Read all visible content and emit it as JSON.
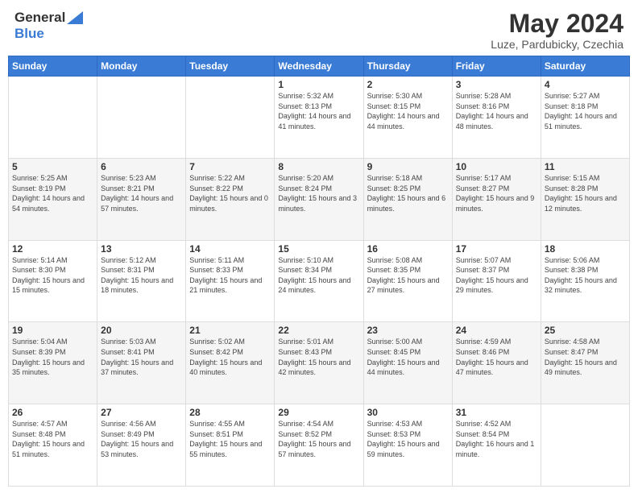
{
  "header": {
    "logo_general": "General",
    "logo_blue": "Blue",
    "title": "May 2024",
    "subtitle": "Luze, Pardubicky, Czechia"
  },
  "days_of_week": [
    "Sunday",
    "Monday",
    "Tuesday",
    "Wednesday",
    "Thursday",
    "Friday",
    "Saturday"
  ],
  "weeks": [
    [
      {
        "day": "",
        "sunrise": "",
        "sunset": "",
        "daylight": ""
      },
      {
        "day": "",
        "sunrise": "",
        "sunset": "",
        "daylight": ""
      },
      {
        "day": "",
        "sunrise": "",
        "sunset": "",
        "daylight": ""
      },
      {
        "day": "1",
        "sunrise": "Sunrise: 5:32 AM",
        "sunset": "Sunset: 8:13 PM",
        "daylight": "Daylight: 14 hours and 41 minutes."
      },
      {
        "day": "2",
        "sunrise": "Sunrise: 5:30 AM",
        "sunset": "Sunset: 8:15 PM",
        "daylight": "Daylight: 14 hours and 44 minutes."
      },
      {
        "day": "3",
        "sunrise": "Sunrise: 5:28 AM",
        "sunset": "Sunset: 8:16 PM",
        "daylight": "Daylight: 14 hours and 48 minutes."
      },
      {
        "day": "4",
        "sunrise": "Sunrise: 5:27 AM",
        "sunset": "Sunset: 8:18 PM",
        "daylight": "Daylight: 14 hours and 51 minutes."
      }
    ],
    [
      {
        "day": "5",
        "sunrise": "Sunrise: 5:25 AM",
        "sunset": "Sunset: 8:19 PM",
        "daylight": "Daylight: 14 hours and 54 minutes."
      },
      {
        "day": "6",
        "sunrise": "Sunrise: 5:23 AM",
        "sunset": "Sunset: 8:21 PM",
        "daylight": "Daylight: 14 hours and 57 minutes."
      },
      {
        "day": "7",
        "sunrise": "Sunrise: 5:22 AM",
        "sunset": "Sunset: 8:22 PM",
        "daylight": "Daylight: 15 hours and 0 minutes."
      },
      {
        "day": "8",
        "sunrise": "Sunrise: 5:20 AM",
        "sunset": "Sunset: 8:24 PM",
        "daylight": "Daylight: 15 hours and 3 minutes."
      },
      {
        "day": "9",
        "sunrise": "Sunrise: 5:18 AM",
        "sunset": "Sunset: 8:25 PM",
        "daylight": "Daylight: 15 hours and 6 minutes."
      },
      {
        "day": "10",
        "sunrise": "Sunrise: 5:17 AM",
        "sunset": "Sunset: 8:27 PM",
        "daylight": "Daylight: 15 hours and 9 minutes."
      },
      {
        "day": "11",
        "sunrise": "Sunrise: 5:15 AM",
        "sunset": "Sunset: 8:28 PM",
        "daylight": "Daylight: 15 hours and 12 minutes."
      }
    ],
    [
      {
        "day": "12",
        "sunrise": "Sunrise: 5:14 AM",
        "sunset": "Sunset: 8:30 PM",
        "daylight": "Daylight: 15 hours and 15 minutes."
      },
      {
        "day": "13",
        "sunrise": "Sunrise: 5:12 AM",
        "sunset": "Sunset: 8:31 PM",
        "daylight": "Daylight: 15 hours and 18 minutes."
      },
      {
        "day": "14",
        "sunrise": "Sunrise: 5:11 AM",
        "sunset": "Sunset: 8:33 PM",
        "daylight": "Daylight: 15 hours and 21 minutes."
      },
      {
        "day": "15",
        "sunrise": "Sunrise: 5:10 AM",
        "sunset": "Sunset: 8:34 PM",
        "daylight": "Daylight: 15 hours and 24 minutes."
      },
      {
        "day": "16",
        "sunrise": "Sunrise: 5:08 AM",
        "sunset": "Sunset: 8:35 PM",
        "daylight": "Daylight: 15 hours and 27 minutes."
      },
      {
        "day": "17",
        "sunrise": "Sunrise: 5:07 AM",
        "sunset": "Sunset: 8:37 PM",
        "daylight": "Daylight: 15 hours and 29 minutes."
      },
      {
        "day": "18",
        "sunrise": "Sunrise: 5:06 AM",
        "sunset": "Sunset: 8:38 PM",
        "daylight": "Daylight: 15 hours and 32 minutes."
      }
    ],
    [
      {
        "day": "19",
        "sunrise": "Sunrise: 5:04 AM",
        "sunset": "Sunset: 8:39 PM",
        "daylight": "Daylight: 15 hours and 35 minutes."
      },
      {
        "day": "20",
        "sunrise": "Sunrise: 5:03 AM",
        "sunset": "Sunset: 8:41 PM",
        "daylight": "Daylight: 15 hours and 37 minutes."
      },
      {
        "day": "21",
        "sunrise": "Sunrise: 5:02 AM",
        "sunset": "Sunset: 8:42 PM",
        "daylight": "Daylight: 15 hours and 40 minutes."
      },
      {
        "day": "22",
        "sunrise": "Sunrise: 5:01 AM",
        "sunset": "Sunset: 8:43 PM",
        "daylight": "Daylight: 15 hours and 42 minutes."
      },
      {
        "day": "23",
        "sunrise": "Sunrise: 5:00 AM",
        "sunset": "Sunset: 8:45 PM",
        "daylight": "Daylight: 15 hours and 44 minutes."
      },
      {
        "day": "24",
        "sunrise": "Sunrise: 4:59 AM",
        "sunset": "Sunset: 8:46 PM",
        "daylight": "Daylight: 15 hours and 47 minutes."
      },
      {
        "day": "25",
        "sunrise": "Sunrise: 4:58 AM",
        "sunset": "Sunset: 8:47 PM",
        "daylight": "Daylight: 15 hours and 49 minutes."
      }
    ],
    [
      {
        "day": "26",
        "sunrise": "Sunrise: 4:57 AM",
        "sunset": "Sunset: 8:48 PM",
        "daylight": "Daylight: 15 hours and 51 minutes."
      },
      {
        "day": "27",
        "sunrise": "Sunrise: 4:56 AM",
        "sunset": "Sunset: 8:49 PM",
        "daylight": "Daylight: 15 hours and 53 minutes."
      },
      {
        "day": "28",
        "sunrise": "Sunrise: 4:55 AM",
        "sunset": "Sunset: 8:51 PM",
        "daylight": "Daylight: 15 hours and 55 minutes."
      },
      {
        "day": "29",
        "sunrise": "Sunrise: 4:54 AM",
        "sunset": "Sunset: 8:52 PM",
        "daylight": "Daylight: 15 hours and 57 minutes."
      },
      {
        "day": "30",
        "sunrise": "Sunrise: 4:53 AM",
        "sunset": "Sunset: 8:53 PM",
        "daylight": "Daylight: 15 hours and 59 minutes."
      },
      {
        "day": "31",
        "sunrise": "Sunrise: 4:52 AM",
        "sunset": "Sunset: 8:54 PM",
        "daylight": "Daylight: 16 hours and 1 minute."
      },
      {
        "day": "",
        "sunrise": "",
        "sunset": "",
        "daylight": ""
      }
    ]
  ]
}
